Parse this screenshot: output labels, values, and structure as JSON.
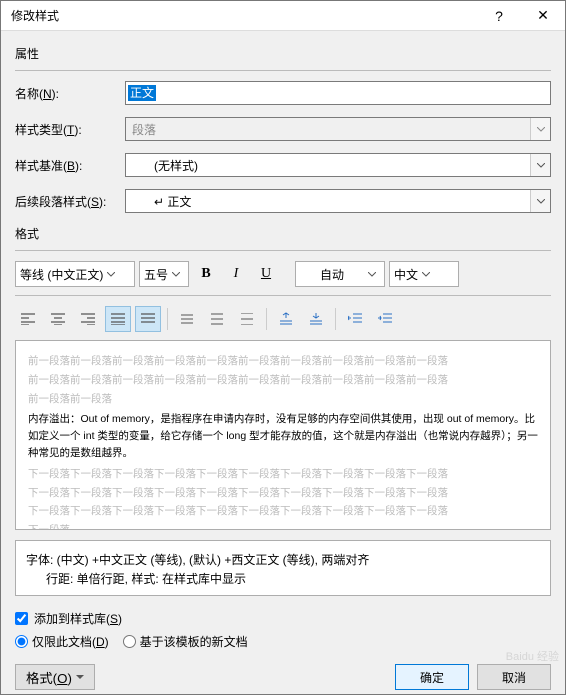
{
  "titlebar": {
    "title": "修改样式"
  },
  "sections": {
    "properties": "属性",
    "format": "格式"
  },
  "labels": {
    "name": "名称(N):",
    "style_type": "样式类型(T):",
    "style_based": "样式基准(B):",
    "next_style": "后续段落样式(S):"
  },
  "values": {
    "name": "正文",
    "style_type": "段落",
    "style_based": "(无样式)",
    "next_style": "↵ 正文"
  },
  "toolbar": {
    "font": "等线 (中文正文)",
    "size": "五号",
    "color": "自动",
    "lang": "中文"
  },
  "preview": {
    "gray1": "前一段落前一段落前一段落前一段落前一段落前一段落前一段落前一段落前一段落前一段落",
    "gray2": "前一段落前一段落前一段落前一段落前一段落前一段落前一段落前一段落前一段落前一段落",
    "gray3": "前一段落前一段落",
    "content": "内存溢出：Out of memory，是指程序在申请内存时，没有足够的内存空间供其使用，出现 out of memory。比如定义一个 int 类型的变量，给它存储一个 long 型才能存放的值，这个就是内存溢出（也常说内存越界）；另一种常见的是数组越界。",
    "gray4": "下一段落下一段落下一段落下一段落下一段落下一段落下一段落下一段落下一段落下一段落",
    "gray5": "下一段落下一段落下一段落下一段落下一段落下一段落下一段落下一段落下一段落下一段落",
    "gray6": "下一段落下一段落下一段落下一段落下一段落下一段落下一段落下一段落下一段落下一段落",
    "gray7": "下一段落"
  },
  "description": {
    "line1": "字体: (中文) +中文正文 (等线), (默认) +西文正文 (等线), 两端对齐",
    "line2": "行距: 单倍行距, 样式: 在样式库中显示"
  },
  "options": {
    "add_to_gallery": "添加到样式库(S)",
    "only_this_doc": "仅限此文档(D)",
    "based_on_template": "基于该模板的新文档"
  },
  "buttons": {
    "format": "格式(O)",
    "ok": "确定",
    "cancel": "取消"
  }
}
